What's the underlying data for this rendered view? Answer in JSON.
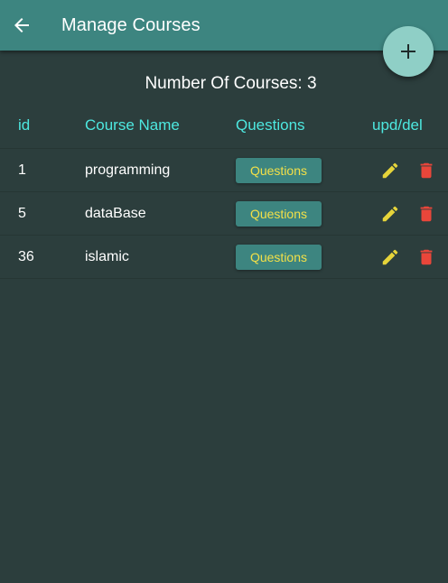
{
  "appbar": {
    "title": "Manage Courses",
    "back_icon": "arrow-back-icon",
    "color": "#3d8580"
  },
  "fab": {
    "icon": "plus-icon",
    "color": "#8fcfc6"
  },
  "summary": {
    "text": "Number Of Courses: 3"
  },
  "table": {
    "headers": {
      "id": "id",
      "name": "Course Name",
      "questions": "Questions",
      "actions": "upd/del"
    },
    "header_color": "#4de8e0",
    "rows": [
      {
        "id": "1",
        "name": "programming",
        "questions_label": "Questions"
      },
      {
        "id": "5",
        "name": "dataBase",
        "questions_label": "Questions"
      },
      {
        "id": "36",
        "name": "islamic",
        "questions_label": "Questions"
      }
    ],
    "edit_icon": "pencil-icon",
    "delete_icon": "trash-icon",
    "edit_color": "#e6d43a",
    "delete_color": "#e9463a"
  }
}
